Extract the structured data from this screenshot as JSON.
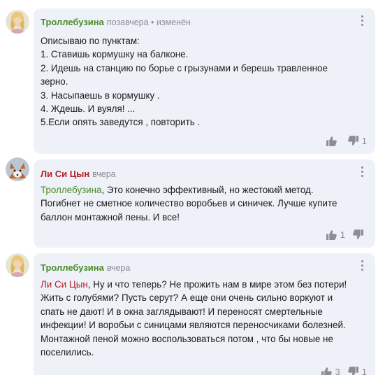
{
  "comments": [
    {
      "author": "Троллебузина",
      "meta": "позавчера • изменён",
      "lines": [
        "Описываю по пунктам:",
        "1. Ставишь кормушку на балконе.",
        "2. Идешь на станцию по борье с грызунами и берешь травленное",
        "зерно.",
        "3. Насыпаешь в кормушку .",
        "4. Ждешь. И вуяля! ...",
        "5.Если опять заведутся , повторить ."
      ],
      "likes": "",
      "dislikes": "1"
    },
    {
      "author": "Ли Си Цын",
      "meta": "вчера",
      "mention": "Троллебузина",
      "first_line_rest": ", Это конечно эффективный, но жестокий метод.",
      "lines": [
        "Погибнет не сметное количество воробьев и синичек. Лучше купите",
        "баллон монтажной пены. И все!"
      ],
      "likes": "1",
      "dislikes": ""
    },
    {
      "author": "Троллебузина",
      "meta": "вчера",
      "mention": "Ли Си Цын",
      "first_line_rest": ", Ну и что теперь? Не прожить нам в мире этом без потери!",
      "lines": [
        "Жить с голубями? Пусть серут? А еще они очень сильно воркуют и",
        "спать не дают! И в окна заглядывают! И переносят смертельные",
        "инфекции! И воробьи с синицами являются переносчиками болезней.",
        "Монтажной пеной можно воспользоваться потом , что бы новые не",
        "поселились."
      ],
      "likes": "3",
      "dislikes": "1"
    }
  ]
}
